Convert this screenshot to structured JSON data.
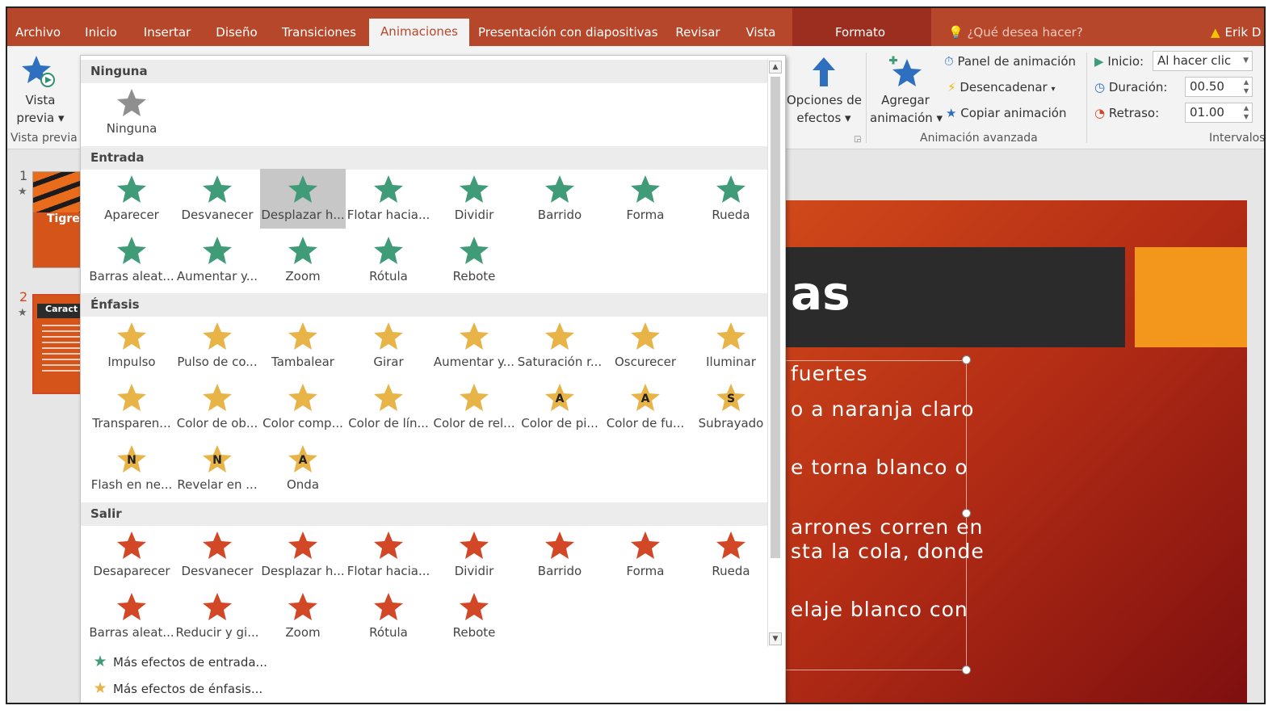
{
  "tabs": [
    {
      "label": "Archivo"
    },
    {
      "label": "Inicio"
    },
    {
      "label": "Insertar"
    },
    {
      "label": "Diseño"
    },
    {
      "label": "Transiciones"
    },
    {
      "label": "Animaciones"
    },
    {
      "label": "Presentación con diapositivas"
    },
    {
      "label": "Revisar"
    },
    {
      "label": "Vista"
    },
    {
      "label": "Formato"
    }
  ],
  "tell_me": "¿Qué desea hacer?",
  "user": "Erik D",
  "ribbon": {
    "preview_label": "Vista",
    "preview_label2": "previa",
    "preview_group": "Vista previa",
    "effects_label": "Opciones de",
    "effects_label2": "efectos",
    "add_label": "Agregar",
    "add_label2": "animación",
    "panel": "Panel de animación",
    "trigger": "Desencadenar",
    "copy": "Copiar animación",
    "advanced_group": "Animación avanzada",
    "start_label": "Inicio:",
    "start_value": "Al hacer clic",
    "duration_label": "Duración:",
    "duration_value": "00.50",
    "delay_label": "Retraso:",
    "delay_value": "01.00",
    "timing_group": "Intervalos"
  },
  "slides": [
    {
      "num": "1",
      "title": "Tigre"
    },
    {
      "num": "2",
      "title": "Caract"
    }
  ],
  "slide": {
    "title": "as",
    "lines": [
      "fuertes",
      "o a naranja claro",
      "e torna blanco o",
      "arrones corren en",
      "sta la cola, donde",
      "elaje blanco con"
    ]
  },
  "colors": {
    "entrada": "#3f9b78",
    "enfasis": "#e8b347",
    "salir": "#d24726",
    "accent": "#b7472a"
  },
  "gallery": {
    "sections": [
      {
        "title": "Ninguna",
        "items": [
          {
            "label": "Ninguna",
            "icon": "gray-star"
          }
        ]
      },
      {
        "title": "Entrada",
        "items": [
          {
            "label": "Aparecer",
            "icon": "green-star-burst"
          },
          {
            "label": "Desvanecer",
            "icon": "green-star-fade"
          },
          {
            "label": "Desplazar h...",
            "icon": "green-star-arrow",
            "selected": true
          },
          {
            "label": "Flotar hacia...",
            "icon": "green-star-float"
          },
          {
            "label": "Dividir",
            "icon": "green-star-split"
          },
          {
            "label": "Barrido",
            "icon": "green-star-wipe"
          },
          {
            "label": "Forma",
            "icon": "green-star-shape"
          },
          {
            "label": "Rueda",
            "icon": "green-star-wheel"
          },
          {
            "label": "Barras aleat...",
            "icon": "green-star-bars"
          },
          {
            "label": "Aumentar y...",
            "icon": "green-star-grow"
          },
          {
            "label": "Zoom",
            "icon": "green-star-zoom"
          },
          {
            "label": "Rótula",
            "icon": "green-star-swivel"
          },
          {
            "label": "Rebote",
            "icon": "green-star-bounce"
          }
        ]
      },
      {
        "title": "Énfasis",
        "items": [
          {
            "label": "Impulso",
            "icon": "gold-star-pulse"
          },
          {
            "label": "Pulso de co...",
            "icon": "gold-star-color-pulse"
          },
          {
            "label": "Tambalear",
            "icon": "gold-star-teeter"
          },
          {
            "label": "Girar",
            "icon": "gold-star-spin"
          },
          {
            "label": "Aumentar y...",
            "icon": "gold-star-grow"
          },
          {
            "label": "Saturación r...",
            "icon": "gold-star-desaturate"
          },
          {
            "label": "Oscurecer",
            "icon": "gold-star-darken"
          },
          {
            "label": "Iluminar",
            "icon": "gold-star-lighten"
          },
          {
            "label": "Transparen...",
            "icon": "gold-star-transparency"
          },
          {
            "label": "Color de ob...",
            "icon": "gold-star-object-color"
          },
          {
            "label": "Color comp...",
            "icon": "gold-star-complementary"
          },
          {
            "label": "Color de lín...",
            "icon": "gold-star-line-color"
          },
          {
            "label": "Color de rel...",
            "icon": "gold-star-fill-color"
          },
          {
            "label": "Color de pi...",
            "icon": "gold-star-brush-color",
            "glyph": "A"
          },
          {
            "label": "Color de fu...",
            "icon": "gold-star-font-color",
            "glyph": "A"
          },
          {
            "label": "Subrayado",
            "icon": "gold-star-underline",
            "glyph": "S"
          },
          {
            "label": "Flash en ne...",
            "icon": "gold-star-bold-flash",
            "glyph": "N"
          },
          {
            "label": "Revelar en ...",
            "icon": "gold-star-bold-reveal",
            "glyph": "N"
          },
          {
            "label": "Onda",
            "icon": "gold-star-wave",
            "glyph": "A"
          }
        ]
      },
      {
        "title": "Salir",
        "items": [
          {
            "label": "Desaparecer",
            "icon": "red-star-disappear"
          },
          {
            "label": "Desvanecer",
            "icon": "red-star-fade"
          },
          {
            "label": "Desplazar h...",
            "icon": "red-star-fly"
          },
          {
            "label": "Flotar hacia...",
            "icon": "red-star-float"
          },
          {
            "label": "Dividir",
            "icon": "red-star-split"
          },
          {
            "label": "Barrido",
            "icon": "red-star-wipe"
          },
          {
            "label": "Forma",
            "icon": "red-star-shape"
          },
          {
            "label": "Rueda",
            "icon": "red-star-wheel"
          },
          {
            "label": "Barras aleat...",
            "icon": "red-star-bars"
          },
          {
            "label": "Reducir y gi...",
            "icon": "red-star-shrink"
          },
          {
            "label": "Zoom",
            "icon": "red-star-zoom"
          },
          {
            "label": "Rótula",
            "icon": "red-star-swivel"
          },
          {
            "label": "Rebote",
            "icon": "red-star-bounce"
          }
        ]
      }
    ],
    "more_entrance": "Más efectos de entrada...",
    "more_emphasis": "Más efectos de énfasis..."
  }
}
